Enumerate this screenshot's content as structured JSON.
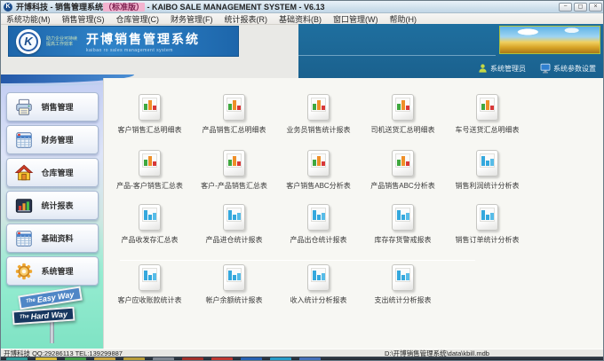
{
  "window": {
    "title_pre": "开博科技 - 销售管理系统",
    "title_badge": "（标准版）",
    "title_post": " - KAIBO SALE MANAGEMENT SYSTEM - V6.13",
    "logo_letter": "K",
    "controls": {
      "minimize": "−",
      "maximize": "◻",
      "close": "×"
    }
  },
  "menu": {
    "items": [
      "系统功能(M)",
      "销售管理(S)",
      "仓库管理(C)",
      "财务管理(F)",
      "统计报表(R)",
      "基础资料(B)",
      "窗口管理(W)",
      "帮助(H)"
    ]
  },
  "header": {
    "logo_letter": "K",
    "slogan_line1": "助力企业可持续",
    "slogan_line2": "提高工作效率",
    "banner_title": "开博销售管理系统",
    "banner_subtitle": "kaibao ro sales management system",
    "user_label": "系统管理员",
    "settings_label": "系统参数设置"
  },
  "sidebar": {
    "items": [
      {
        "label": "销售管理",
        "icon": "printer-icon"
      },
      {
        "label": "财务管理",
        "icon": "spreadsheet-icon"
      },
      {
        "label": "仓库管理",
        "icon": "home-icon"
      },
      {
        "label": "统计报表",
        "icon": "bar-chart-icon"
      },
      {
        "label": "基础资料",
        "icon": "spreadsheet-icon"
      },
      {
        "label": "系统管理",
        "icon": "gear-icon"
      }
    ]
  },
  "sign": {
    "prefix": "The",
    "easy": "Easy Way",
    "hard": "Hard Way"
  },
  "main": {
    "report_rows": [
      [
        {
          "label": "客户销售汇总明细表",
          "variant": "color"
        },
        {
          "label": "产品销售汇总明细表",
          "variant": "color"
        },
        {
          "label": "业务员销售统计报表",
          "variant": "color"
        },
        {
          "label": "司机送货汇总明细表",
          "variant": "color"
        },
        {
          "label": "车号送货汇总明细表",
          "variant": "color"
        }
      ],
      [
        {
          "label": "产品-客户销售汇总表",
          "variant": "color"
        },
        {
          "label": "客户-产品销售汇总表",
          "variant": "color"
        },
        {
          "label": "客户销售ABC分析表",
          "variant": "color"
        },
        {
          "label": "产品销售ABC分析表",
          "variant": "color"
        },
        {
          "label": "销售利润统计分析表",
          "variant": "blue"
        }
      ],
      [
        {
          "label": "产品收发存汇总表",
          "variant": "blue"
        },
        {
          "label": "产品进仓统计报表",
          "variant": "blue"
        },
        {
          "label": "产品出仓统计报表",
          "variant": "blue"
        },
        {
          "label": "库存存货警戒报表",
          "variant": "blue"
        },
        {
          "label": "销售订单统计分析表",
          "variant": "blue"
        }
      ],
      [
        {
          "label": "客户应收账款统计表",
          "variant": "blue"
        },
        {
          "label": "帐户余额统计报表",
          "variant": "blue"
        },
        {
          "label": "收入统计分析报表",
          "variant": "blue"
        },
        {
          "label": "支出统计分析报表",
          "variant": "blue"
        }
      ]
    ]
  },
  "statusbar": {
    "left": "开博科技 QQ:29286113 TEL:139299887",
    "right": "D:\\开博销售管理系统\\data\\kbill.mdb"
  },
  "colors": {
    "header_blue": "#1a618e",
    "banner_blue": "#2f83c8",
    "sidebar_mint": "#7fe3c4",
    "badge_pink": "#f3b3cf"
  }
}
